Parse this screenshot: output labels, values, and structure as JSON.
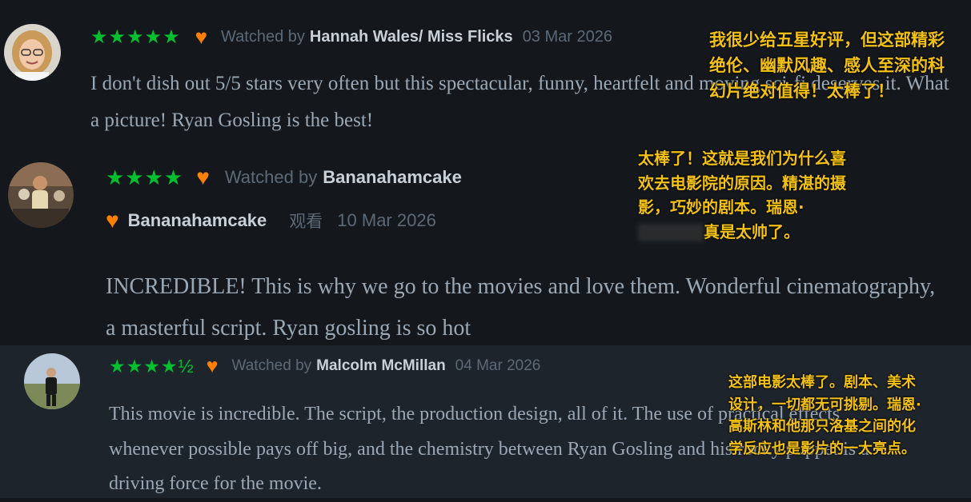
{
  "reviews": [
    {
      "stars": "★★★★★",
      "liked": "♥",
      "watched_label": "Watched by",
      "user": "Hannah Wales/ Miss Flicks",
      "date": "03 Mar 2026",
      "text": "I don't dish out 5/5 stars very often but this spectacular, funny, heartfelt and moving sci-fi deserves it. What a picture! Ryan Gosling is the best!",
      "translation": "我很少给五星好评，但这部精彩绝伦、幽默风趣、感人至深的科幻片绝对值得！太棒了！"
    },
    {
      "stars": "★★★★",
      "liked": "♥",
      "watched_label": "Watched by",
      "user": "Bananahamcake",
      "translated_line_user": "Bananahamcake",
      "translated_line_watched": "观看",
      "date": "10 Mar 2026",
      "text": "INCREDIBLE! This is why we go to the movies and love them. Wonderful cinematography, a masterful script. Ryan gosling is so hot",
      "translation_part1": "太棒了！这就是我们为什么喜欢去电影院的原因。精湛的摄影，巧妙的剧本。瑞恩·",
      "translation_part2": "真是太帅了。"
    },
    {
      "stars": "★★★★½",
      "liked": "♥",
      "watched_label": "Watched by",
      "user": "Malcolm McMillan",
      "date": "04 Mar 2026",
      "text": "This movie is incredible. The script, the production design, all of it. The use of practical effects whenever possible pays off big, and the chemistry between Ryan Gosling and his rocky puppet is a driving force for the movie.",
      "translation": "这部电影太棒了。剧本、美术设计，一切都无可挑剔。瑞恩·高斯林和他那只洛基之间的化学反应也是影片的一大亮点。"
    }
  ]
}
